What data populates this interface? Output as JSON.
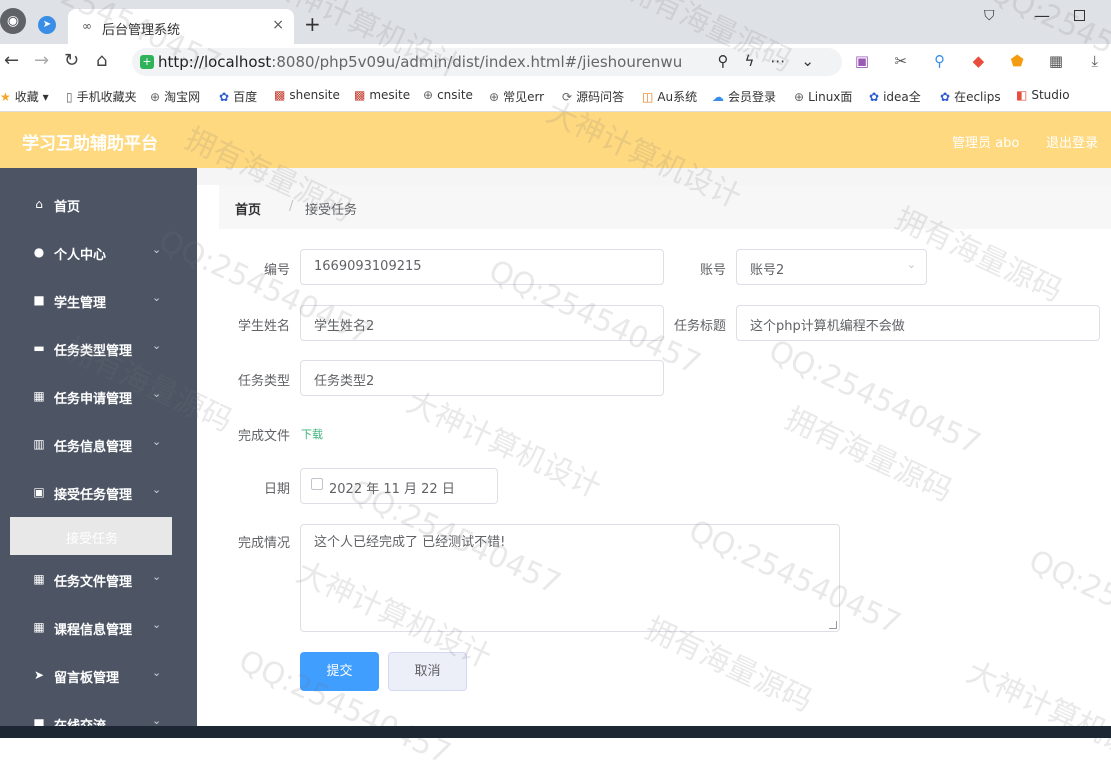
{
  "browser": {
    "tab_title": "后台管理系统",
    "tab_close": "×",
    "new_tab": "+",
    "url_host": "http://localhost",
    "url_rest": ":8080/php5v09u/admin/dist/index.html#/jieshourenwu",
    "bookmarks": [
      "收藏",
      "手机收藏夹",
      "淘宝网",
      "百度",
      "shensite",
      "mesite",
      "cnsite",
      "常见err",
      "源码问答",
      "Au系统",
      "会员登录",
      "Linux面",
      "idea全",
      "在eclips",
      "Studio"
    ]
  },
  "header": {
    "title": "学习互助辅助平台",
    "user": "管理员 abo",
    "logout": "退出登录"
  },
  "sidebar": {
    "items": [
      {
        "label": "首页",
        "icon": "home-icon",
        "glyph": "⌂",
        "chevron": false
      },
      {
        "label": "个人中心",
        "icon": "user-icon",
        "glyph": "●",
        "chevron": true
      },
      {
        "label": "学生管理",
        "icon": "briefcase-icon",
        "glyph": "■",
        "chevron": true
      },
      {
        "label": "任务类型管理",
        "icon": "ticket-icon",
        "glyph": "▬",
        "chevron": true
      },
      {
        "label": "任务申请管理",
        "icon": "grid-icon",
        "glyph": "▦",
        "chevron": true
      },
      {
        "label": "任务信息管理",
        "icon": "bar-chart-icon",
        "glyph": "▥",
        "chevron": true
      },
      {
        "label": "接受任务管理",
        "icon": "clipboard-check-icon",
        "glyph": "▣",
        "chevron": true
      },
      {
        "label": "任务文件管理",
        "icon": "grid-icon",
        "glyph": "▦",
        "chevron": true
      },
      {
        "label": "课程信息管理",
        "icon": "table-icon",
        "glyph": "▦",
        "chevron": true
      },
      {
        "label": "留言板管理",
        "icon": "send-icon",
        "glyph": "➤",
        "chevron": true
      },
      {
        "label": "在线交流",
        "icon": "chat-icon",
        "glyph": "■",
        "chevron": true
      }
    ],
    "active_sub": "接受任务"
  },
  "breadcrumb": {
    "home": "首页",
    "sep": "/",
    "current": "接受任务"
  },
  "form": {
    "bianhao_label": "编号",
    "bianhao_value": "1669093109215",
    "zhanghao_label": "账号",
    "zhanghao_value": "账号2",
    "xingming_label": "学生姓名",
    "xingming_value": "学生姓名2",
    "biaoti_label": "任务标题",
    "biaoti_value": "这个php计算机编程不会做",
    "leixing_label": "任务类型",
    "leixing_value": "任务类型2",
    "wenjian_label": "完成文件",
    "wenjian_link": "下载",
    "riqi_label": "日期",
    "riqi_value": "2022 年 11 月 22 日",
    "qingkuang_label": "完成情况",
    "qingkuang_value": "这个人已经完成了 已经测试不错!",
    "submit": "提交",
    "cancel": "取消"
  },
  "watermark": [
    "QQ:254540457",
    "大神计算机设计",
    "拥有海量源码"
  ]
}
